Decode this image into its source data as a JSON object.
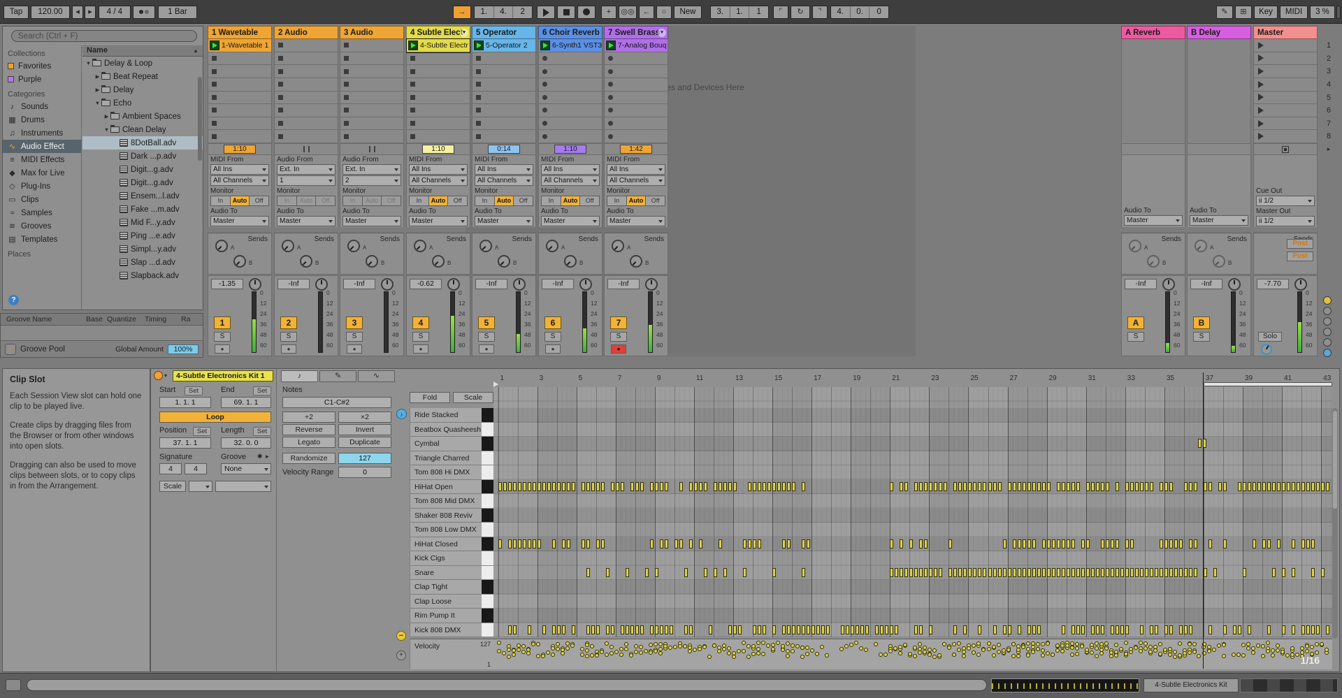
{
  "transport": {
    "tap": "Tap",
    "tempo": "120.00",
    "time_sig": "4 / 4",
    "quantize": "1 Bar",
    "position": [
      "1.",
      "4.",
      "2"
    ],
    "loop_start": [
      "3.",
      "1.",
      "1"
    ],
    "loop_length": [
      "4.",
      "0.",
      "0"
    ],
    "new_label": "New",
    "key_label": "Key",
    "midi_label": "MIDI",
    "cpu": "3 %"
  },
  "browser": {
    "search_placeholder": "Search (Ctrl + F)",
    "collections_header": "Collections",
    "collections": [
      {
        "label": "Favorites",
        "color": "#f0a030"
      },
      {
        "label": "Purple",
        "color": "#b878e8"
      }
    ],
    "categories_header": "Categories",
    "categories": [
      {
        "label": "Sounds",
        "icon": "sounds-icon",
        "selected": false
      },
      {
        "label": "Drums",
        "icon": "drums-icon",
        "selected": false
      },
      {
        "label": "Instruments",
        "icon": "instruments-icon",
        "selected": false
      },
      {
        "label": "Audio Effect",
        "icon": "audio-effect-icon",
        "selected": true
      },
      {
        "label": "MIDI Effects",
        "icon": "midi-effects-icon",
        "selected": false
      },
      {
        "label": "Max for Live",
        "icon": "max-for-live-icon",
        "selected": false
      },
      {
        "label": "Plug-Ins",
        "icon": "plug-ins-icon",
        "selected": false
      },
      {
        "label": "Clips",
        "icon": "clips-icon",
        "selected": false
      },
      {
        "label": "Samples",
        "icon": "samples-icon",
        "selected": false
      },
      {
        "label": "Grooves",
        "icon": "grooves-icon",
        "selected": false
      },
      {
        "label": "Templates",
        "icon": "templates-icon",
        "selected": false
      }
    ],
    "places_header": "Places",
    "name_header": "Name",
    "tree": [
      {
        "label": "Delay & Loop",
        "depth": 0,
        "type": "folder",
        "state": "expanded"
      },
      {
        "label": "Beat Repeat",
        "depth": 1,
        "type": "folder",
        "state": "collapsed"
      },
      {
        "label": "Delay",
        "depth": 1,
        "type": "folder",
        "state": "collapsed"
      },
      {
        "label": "Echo",
        "depth": 1,
        "type": "folder",
        "state": "expanded"
      },
      {
        "label": "Ambient Spaces",
        "depth": 2,
        "type": "folder",
        "state": "collapsed"
      },
      {
        "label": "Clean Delay",
        "depth": 2,
        "type": "folder",
        "state": "expanded"
      },
      {
        "label": "8DotBall.adv",
        "depth": 3,
        "type": "preset",
        "selected": true
      },
      {
        "label": "Dark ...p.adv",
        "depth": 3,
        "type": "preset"
      },
      {
        "label": "Digit...g.adv",
        "depth": 3,
        "type": "preset"
      },
      {
        "label": "Digit...g.adv",
        "depth": 3,
        "type": "preset"
      },
      {
        "label": "Ensem...l.adv",
        "depth": 3,
        "type": "preset"
      },
      {
        "label": "Fake ...m.adv",
        "depth": 3,
        "type": "preset"
      },
      {
        "label": "Mid F...y.adv",
        "depth": 3,
        "type": "preset"
      },
      {
        "label": "Ping ...e.adv",
        "depth": 3,
        "type": "preset"
      },
      {
        "label": "Simpl...y.adv",
        "depth": 3,
        "type": "preset"
      },
      {
        "label": "Slap ...d.adv",
        "depth": 3,
        "type": "preset"
      },
      {
        "label": "Slapback.adv",
        "depth": 3,
        "type": "preset"
      }
    ]
  },
  "groove_pool": {
    "headers": [
      "Groove Name",
      "Base",
      "Quantize",
      "Timing",
      "Ra"
    ],
    "footer_label": "Groove Pool",
    "global_amount_label": "Global Amount",
    "global_amount_value": "100%"
  },
  "info_panel": {
    "title": "Clip Slot",
    "paragraphs": [
      "Each Session View slot can hold one clip to be played live.",
      "Create clips by dragging files from the Browser or from other windows into open slots.",
      "Dragging can also be used to move clips between slots, or to copy clips in from the Arrangement."
    ]
  },
  "session": {
    "drop_hint": "Drop Files and Devices Here",
    "scene_numbers": [
      "1",
      "2",
      "3",
      "4",
      "5",
      "6",
      "7",
      "8"
    ],
    "sends_label": "Sends",
    "monitor_label": "Monitor",
    "monitor_options": [
      "In",
      "Auto",
      "Off"
    ],
    "audio_to_label": "Audio To",
    "meter_scale": [
      "0",
      "12",
      "24",
      "36",
      "48",
      "60"
    ],
    "tracks": [
      {
        "name": "1 Wavetable",
        "color": "#efa534",
        "header_icon": false,
        "clip": {
          "name": "1-Wavetable 1",
          "playing": true
        },
        "timer": "1:10",
        "timer_bg": "#efa534",
        "io_label": "MIDI From",
        "input": "All Ins",
        "channel": "All Channels",
        "monitor": "Auto",
        "audio_to": "Master",
        "volume": "-1.35",
        "pan": "0",
        "id": "1",
        "slot_icon": "square",
        "arm": "off",
        "meter": 0.55
      },
      {
        "name": "2 Audio",
        "color": "#efa534",
        "header_icon": false,
        "clip": null,
        "timer": "",
        "timer_bg": "",
        "io_label": "Audio From",
        "input": "Ext. In",
        "channel": "1",
        "monitor": null,
        "audio_to": "Master",
        "volume": "-Inf",
        "pan": "0",
        "id": "2",
        "slot_icon": "square",
        "arm": "off",
        "meter": 0
      },
      {
        "name": "3 Audio",
        "color": "#efa534",
        "header_icon": false,
        "clip": null,
        "timer": "",
        "timer_bg": "",
        "io_label": "Audio From",
        "input": "Ext. In",
        "channel": "2",
        "monitor": null,
        "audio_to": "Master",
        "volume": "-Inf",
        "pan": "0",
        "id": "3",
        "slot_icon": "square",
        "arm": "off",
        "meter": 0
      },
      {
        "name": "4 Subtle Elect",
        "color": "#e3db49",
        "header_icon": true,
        "clip": {
          "name": "4-Subtle Electr",
          "playing": true,
          "selected": true
        },
        "timer": "1:10",
        "timer_bg": "#f5f1a0",
        "io_label": "MIDI From",
        "input": "All Ins",
        "channel": "All Channels",
        "monitor": "Auto",
        "audio_to": "Master",
        "volume": "-0.62",
        "pan": "0",
        "id": "4",
        "slot_icon": "square",
        "arm": "off",
        "meter": 0.6
      },
      {
        "name": "5 Operator",
        "color": "#66b6e9",
        "header_icon": false,
        "clip": {
          "name": "5-Operator 2",
          "playing": true
        },
        "timer": "0:14",
        "timer_bg": "#8ec4f0",
        "io_label": "MIDI From",
        "input": "All Ins",
        "channel": "All Channels",
        "monitor": "Auto",
        "audio_to": "Master",
        "volume": "-Inf",
        "pan": "0",
        "id": "5",
        "slot_icon": "square",
        "arm": "off",
        "meter": 0.3
      },
      {
        "name": "6 Choir Reverb",
        "color": "#5a8fe4",
        "header_icon": false,
        "clip": {
          "name": "6-Synth1 VST3",
          "playing": true
        },
        "timer": "1:10",
        "timer_bg": "#a57bf0",
        "io_label": "MIDI From",
        "input": "All Ins",
        "channel": "All Channels",
        "monitor": "Auto",
        "audio_to": "Master",
        "volume": "-Inf",
        "pan": "0",
        "id": "6",
        "slot_icon": "circle",
        "arm": "off",
        "meter": 0.4
      },
      {
        "name": "7 Swell Brass",
        "color": "#b06fe8",
        "header_icon": true,
        "clip": {
          "name": "7-Analog Bouq",
          "playing": true
        },
        "timer": "1:42",
        "timer_bg": "#efa534",
        "io_label": "MIDI From",
        "input": "All Ins",
        "channel": "All Channels",
        "monitor": "Auto",
        "audio_to": "Master",
        "volume": "-Inf",
        "pan": "0",
        "id": "7",
        "slot_icon": "circle",
        "arm": "on",
        "meter": 0.45
      }
    ],
    "returns": [
      {
        "name": "A Reverb",
        "color": "#ee5aa0",
        "audio_to": "Master",
        "volume": "-Inf",
        "pan": "0",
        "id": "A",
        "meter": 0.15
      },
      {
        "name": "B Delay",
        "color": "#d65fe0",
        "audio_to": "Master",
        "volume": "-Inf",
        "pan": "0",
        "id": "B",
        "meter": 0.1
      }
    ],
    "master": {
      "name": "Master",
      "color": "#f28f8f",
      "cue_out_label": "Cue Out",
      "cue_out": "ii 1/2",
      "master_out_label": "Master Out",
      "master_out": "ii 1/2",
      "sends_post": [
        "Post",
        "Post"
      ],
      "volume": "-7.70",
      "pan": "0",
      "solo_label": "Solo",
      "meter": 0.5
    }
  },
  "clip_panel": {
    "title": "4-Subtle Electronics Kit 1",
    "start_label": "Start",
    "end_label": "End",
    "set_label": "Set",
    "start_value": "1. 1. 1",
    "end_value": "69. 1. 1",
    "loop_label": "Loop",
    "position_label": "Position",
    "length_label": "Length",
    "position_value": "37. 1. 1",
    "length_value": "32. 0. 0",
    "signature_label": "Signature",
    "sig_num": "4",
    "sig_den": "4",
    "groove_label": "Groove",
    "groove_value": "None",
    "scale_label": "Scale"
  },
  "notes_panel": {
    "header": "Notes",
    "range": "C1-C#2",
    "buttons": [
      [
        "+2",
        "×2"
      ],
      [
        "Reverse",
        "Invert"
      ],
      [
        "Legato",
        "Duplicate"
      ]
    ],
    "randomize_label": "Randomize",
    "randomize_value": "127",
    "velocity_range_label": "Velocity Range",
    "velocity_range_value": "0"
  },
  "editor": {
    "fold_label": "Fold",
    "scale_label": "Scale",
    "rows": [
      {
        "name": "Ride Stacked",
        "key": "black"
      },
      {
        "name": "Beatbox Quasheesh",
        "key": "white"
      },
      {
        "name": "Cymbal",
        "key": "black"
      },
      {
        "name": "Triangle Charred",
        "key": "white"
      },
      {
        "name": "Tom 808 Hi DMX",
        "key": "white"
      },
      {
        "name": "HiHat Open",
        "key": "black"
      },
      {
        "name": "Tom 808 Mid DMX",
        "key": "white"
      },
      {
        "name": "Shaker 808 Reviv",
        "key": "black"
      },
      {
        "name": "Tom 808 Low DMX",
        "key": "white"
      },
      {
        "name": "HiHat Closed",
        "key": "black"
      },
      {
        "name": "Kick Cigs",
        "key": "white"
      },
      {
        "name": "Snare",
        "key": "white"
      },
      {
        "name": "Clap Tight",
        "key": "black"
      },
      {
        "name": "Clap Loose",
        "key": "white"
      },
      {
        "name": "Rim Pump It",
        "key": "black"
      },
      {
        "name": "Kick 808 DMX",
        "key": "white"
      }
    ],
    "ruler_marks": [
      1,
      3,
      5,
      7,
      9,
      11,
      13,
      15,
      17,
      19,
      21,
      23,
      25,
      27,
      29,
      31,
      33,
      35,
      37,
      39,
      41,
      43
    ],
    "playhead_bar": 37,
    "loop_start_bar": 37,
    "velocity_label": "Velocity",
    "velocity_max": "127",
    "velocity_min": "1",
    "zoom_label": "1/16",
    "seed": 7,
    "note_segments": [
      {
        "row": 2,
        "segs": [
          [
            36.7,
            37.1,
            0.25,
            1
          ]
        ]
      },
      {
        "row": 5,
        "segs": [
          [
            1,
            16.9,
            0.25,
            0.82
          ],
          [
            21,
            43.6,
            0.25,
            0.82
          ]
        ]
      },
      {
        "row": 9,
        "segs": [
          [
            1,
            16.9,
            0.25,
            0.5
          ],
          [
            21,
            43.6,
            0.25,
            0.55
          ]
        ]
      },
      {
        "row": 11,
        "segs": [
          [
            5.5,
            16.9,
            0.5,
            0.7
          ],
          [
            21,
            36.9,
            0.25,
            0.95
          ],
          [
            37,
            43.6,
            0.5,
            0.75
          ]
        ]
      },
      {
        "row": 15,
        "segs": [
          [
            1,
            43.6,
            0.25,
            0.6
          ]
        ]
      }
    ]
  },
  "status_bar": {
    "device_name": "4-Subtle Electronics Kit"
  }
}
